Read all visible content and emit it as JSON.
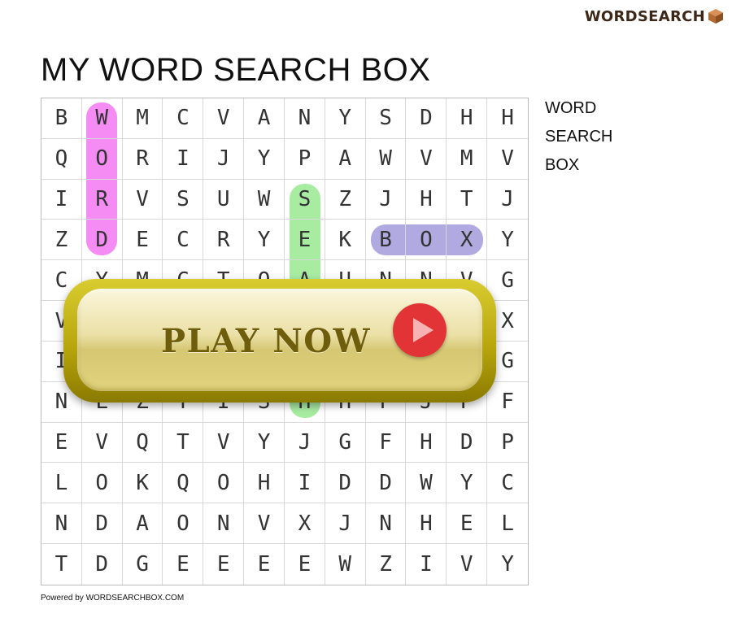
{
  "brand": {
    "text": "WORDSEARCH",
    "logo_icon": "box-icon"
  },
  "title": "MY WORD SEARCH BOX",
  "grid": {
    "rows": [
      "BWMCVANYSDHH",
      "QORIJYPAWVMV",
      "IRVSUWSZJHTJ",
      "ZDECRYEKBOXY",
      "CYMCTOAUNNVG",
      "VZLQZDDSZYLX",
      "IBNPDWAZHKOG",
      "NLZYISHHFJPF",
      "EVQTVYJGFHDP",
      "LOKQOHIDDWYC",
      "NDAONVXJNHEL",
      "TDGEEEEWZIVY"
    ]
  },
  "found_words": [
    {
      "word": "WORD",
      "color": "#f48cf3"
    },
    {
      "word": "SEARCH",
      "color": "#a8eca2"
    },
    {
      "word": "BOX",
      "color": "#b1aae0"
    }
  ],
  "word_list": [
    "WORD",
    "SEARCH",
    "BOX"
  ],
  "play_button": {
    "label": "PLAY NOW",
    "icon": "play-icon",
    "circle_color": "#e23436"
  },
  "footer": "Powered by WORDSEARCHBOX.COM"
}
